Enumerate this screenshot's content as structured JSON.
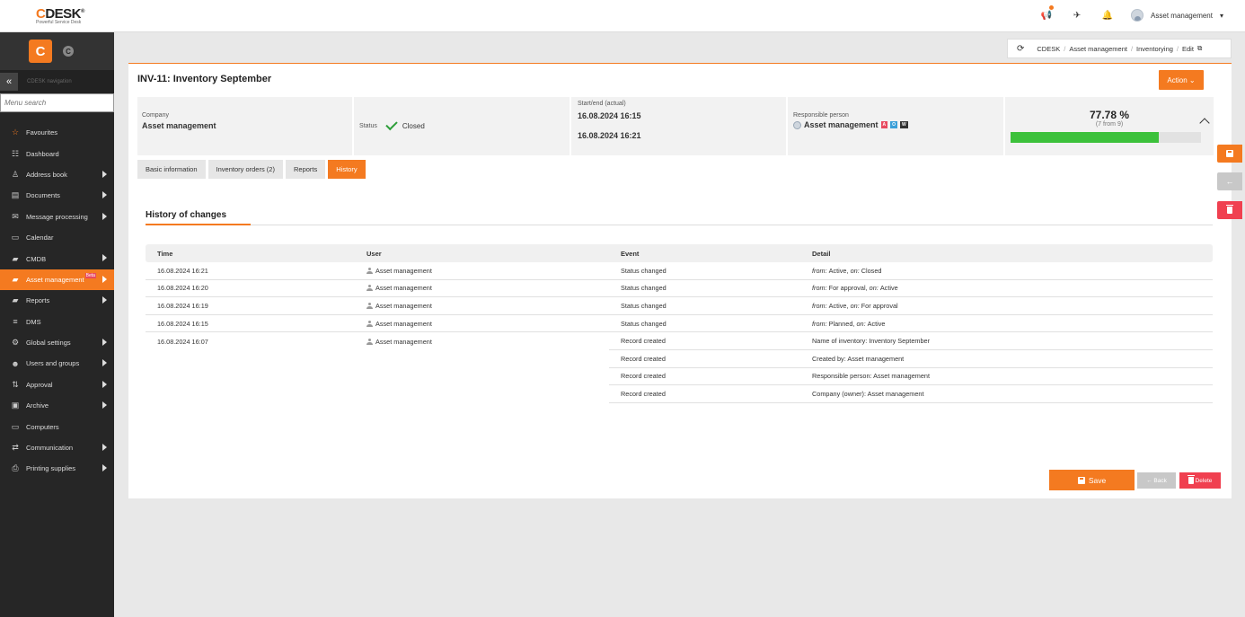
{
  "app": {
    "logo_brand_prefix": "C",
    "logo_brand_rest": "DESK",
    "logo_tagline": "Powerful Service Desk",
    "user_name": "Asset management"
  },
  "sidebar": {
    "logo_letter": "C",
    "logo_letter2": "C",
    "nav_label": "CDESK navigation",
    "search_placeholder": "Menu search",
    "items": [
      {
        "label": "Favourites",
        "icon": "star-icon",
        "glyph": "☆",
        "arrow": false
      },
      {
        "label": "Dashboard",
        "icon": "dashboard-icon",
        "glyph": "☷",
        "arrow": false
      },
      {
        "label": "Address book",
        "icon": "person-icon",
        "glyph": "♙",
        "arrow": true
      },
      {
        "label": "Documents",
        "icon": "documents-icon",
        "glyph": "▤",
        "arrow": true
      },
      {
        "label": "Message processing",
        "icon": "envelope-icon",
        "glyph": "✉",
        "arrow": true
      },
      {
        "label": "Calendar",
        "icon": "calendar-icon",
        "glyph": "▭",
        "arrow": false
      },
      {
        "label": "CMDB",
        "icon": "folder-icon",
        "glyph": "▰",
        "arrow": true
      },
      {
        "label": "Asset management",
        "icon": "folder-open-icon",
        "glyph": "▰",
        "arrow": true,
        "badge": "Beta",
        "active": true
      },
      {
        "label": "Reports",
        "icon": "folder-icon",
        "glyph": "▰",
        "arrow": true
      },
      {
        "label": "DMS",
        "icon": "database-icon",
        "glyph": "≡",
        "arrow": false
      },
      {
        "label": "Global settings",
        "icon": "gears-icon",
        "glyph": "⚙",
        "arrow": true
      },
      {
        "label": "Users and groups",
        "icon": "users-icon",
        "glyph": "☻",
        "arrow": true
      },
      {
        "label": "Approval",
        "icon": "approval-icon",
        "glyph": "⇅",
        "arrow": true
      },
      {
        "label": "Archive",
        "icon": "archive-icon",
        "glyph": "▣",
        "arrow": true
      },
      {
        "label": "Computers",
        "icon": "laptop-icon",
        "glyph": "▭",
        "arrow": false
      },
      {
        "label": "Communication",
        "icon": "exchange-icon",
        "glyph": "⇄",
        "arrow": true
      },
      {
        "label": "Printing supplies",
        "icon": "printer-icon",
        "glyph": "⎙",
        "arrow": true
      }
    ]
  },
  "breadcrumb": [
    "CDESK",
    "Asset management",
    "Inventorying",
    "Edit"
  ],
  "page": {
    "title": "INV-11: Inventory September",
    "action_label": "Action"
  },
  "summary": {
    "company_label": "Company",
    "company_value": "Asset management",
    "status_label": "Status",
    "status_value": "Closed",
    "startend_label": "Start/end (actual)",
    "start_value": "16.08.2024 16:15",
    "end_value": "16.08.2024 16:21",
    "responsible_label": "Responsible person",
    "responsible_value": "Asset management",
    "badges": [
      "A",
      "O",
      "W"
    ],
    "percent_text": "77.78 %",
    "percent_sub": "(7 from 9)",
    "progress": 0.7778
  },
  "tabs": [
    {
      "label": "Basic information",
      "active": false
    },
    {
      "label": "Inventory orders (2)",
      "active": false
    },
    {
      "label": "Reports",
      "active": false
    },
    {
      "label": "History",
      "active": true
    }
  ],
  "history": {
    "title": "History of changes",
    "columns": [
      "Time",
      "User",
      "Event",
      "Detail"
    ],
    "rows": [
      {
        "time": "16.08.2024 16:21",
        "user": "Asset management",
        "event": "Status changed",
        "from_key": "from:",
        "from_val": "Active,",
        "on_key": "on:",
        "on_val": "Closed"
      },
      {
        "time": "16.08.2024 16:20",
        "user": "Asset management",
        "event": "Status changed",
        "from_key": "from:",
        "from_val": "For approval,",
        "on_key": "on:",
        "on_val": "Active"
      },
      {
        "time": "16.08.2024 16:19",
        "user": "Asset management",
        "event": "Status changed",
        "from_key": "from:",
        "from_val": "Active,",
        "on_key": "on:",
        "on_val": "For approval"
      },
      {
        "time": "16.08.2024 16:15",
        "user": "Asset management",
        "event": "Status changed",
        "from_key": "from:",
        "from_val": "Planned,",
        "on_key": "on:",
        "on_val": "Active"
      }
    ],
    "created": {
      "time": "16.08.2024 16:07",
      "user": "Asset management",
      "events": [
        {
          "event": "Record created",
          "detail": "Name of inventory: Inventory September"
        },
        {
          "event": "Record created",
          "detail": "Created by: Asset management"
        },
        {
          "event": "Record created",
          "detail": "Responsible person: Asset management"
        },
        {
          "event": "Record created",
          "detail": "Company (owner): Asset management"
        }
      ]
    }
  },
  "footer": {
    "save_label": "Save",
    "back_label": "← Back",
    "delete_label": "Delete"
  }
}
